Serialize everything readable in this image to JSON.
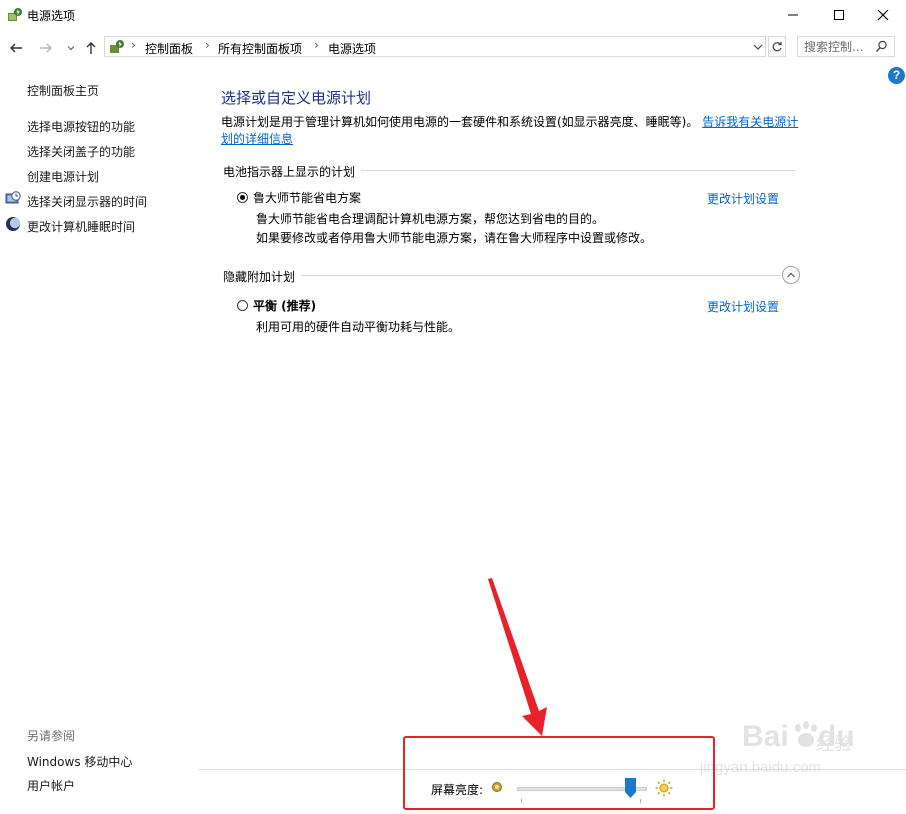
{
  "window": {
    "title": "电源选项",
    "minimize_symbol": "—",
    "maximize_symbol": "☐",
    "close_symbol": "✕"
  },
  "nav": {
    "breadcrumbs": [
      "控制面板",
      "所有控制面板项",
      "电源选项"
    ],
    "separator": "›",
    "search_placeholder": "搜索控制...",
    "help_symbol": "?"
  },
  "sidebar": {
    "items": [
      {
        "label": "控制面板主页",
        "icon": ""
      },
      {
        "label": "选择电源按钮的功能",
        "icon": ""
      },
      {
        "label": "选择关闭盖子的功能",
        "icon": ""
      },
      {
        "label": "创建电源计划",
        "icon": ""
      },
      {
        "label": "选择关闭显示器的时间",
        "icon": "monitor-clock-icon"
      },
      {
        "label": "更改计算机睡眠时间",
        "icon": "moon-icon"
      }
    ],
    "see_also": {
      "heading": "另请参阅",
      "items": [
        "Windows 移动中心",
        "用户帐户"
      ]
    }
  },
  "main": {
    "title": "选择或自定义电源计划",
    "description": "电源计划是用于管理计算机如何使用电源的一套硬件和系统设置(如显示器亮度、睡眠等)。",
    "description_link": "告诉我有关电源计划的详细信息",
    "battery_group": {
      "heading": "电池指示器上显示的计划",
      "plan": {
        "name": "鲁大师节能省电方案",
        "selected": true,
        "desc_lines": [
          "鲁大师节能省电合理调配计算机电源方案，帮您达到省电的目的。",
          "如果要修改或者停用鲁大师节能电源方案，请在鲁大师程序中设置或修改。"
        ],
        "change_link": "更改计划设置"
      }
    },
    "hidden_group": {
      "heading": "隐藏附加计划",
      "plan": {
        "name": "平衡 (推荐)",
        "selected": false,
        "desc_lines": [
          "利用可用的硬件自动平衡功耗与性能。"
        ],
        "change_link": "更改计划设置"
      }
    }
  },
  "brightness": {
    "label": "屏幕亮度:",
    "value_fraction": 0.87
  },
  "watermark": {
    "brand": "Bai",
    "brand2": "du",
    "cn": "经验",
    "url": "jingyan.baidu.com"
  },
  "colors": {
    "accent": "#0066cc",
    "title_blue": "#1e3287",
    "annotation_red": "#e8212b",
    "slider_thumb": "#1979ca"
  }
}
